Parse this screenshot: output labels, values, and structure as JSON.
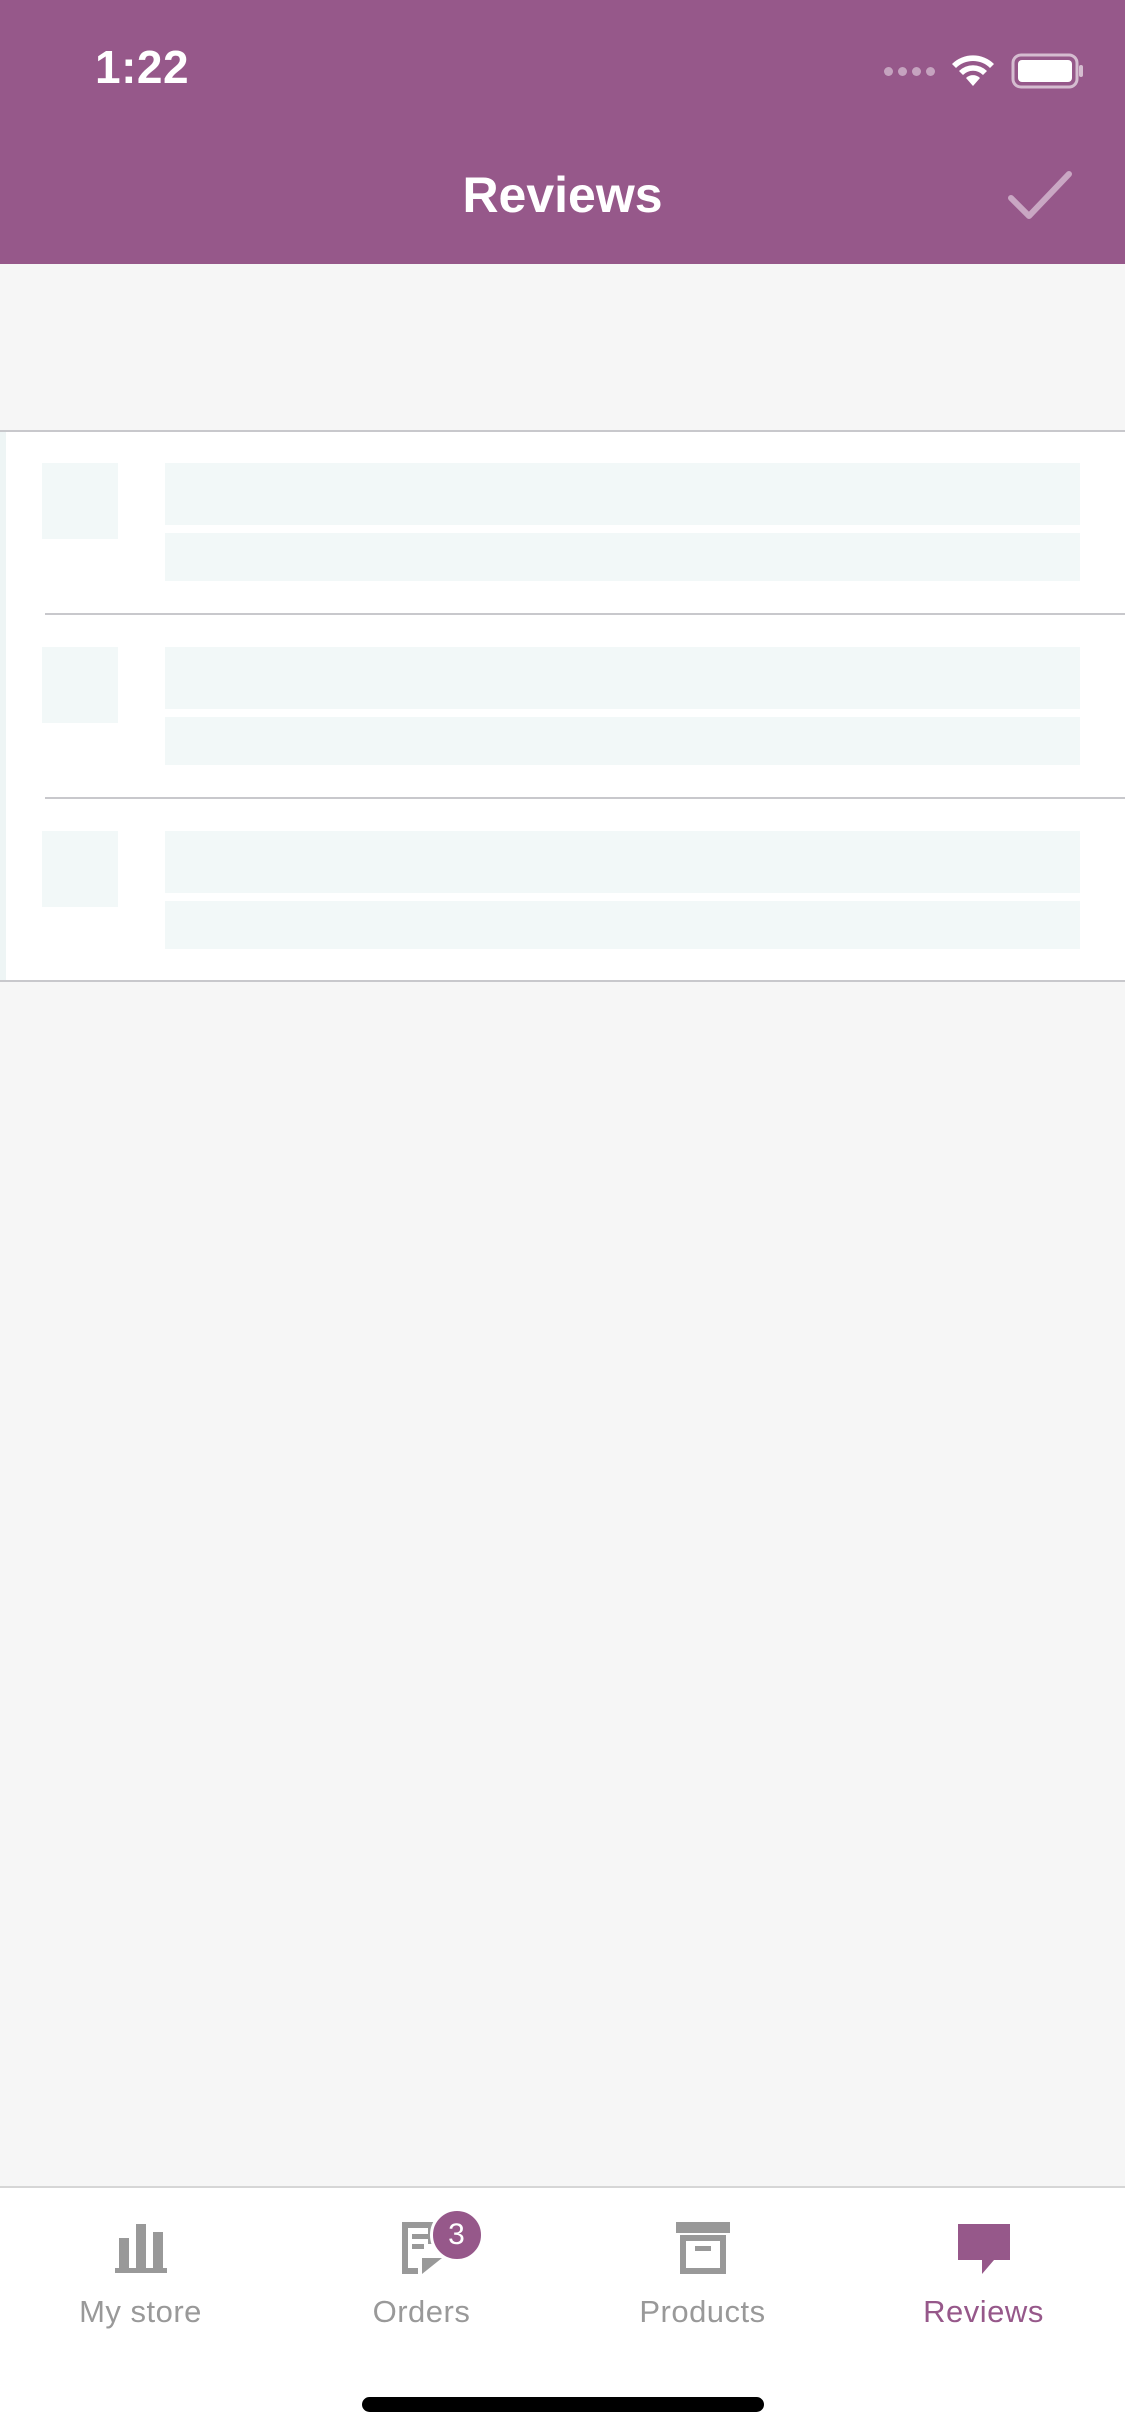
{
  "status_bar": {
    "time": "1:22"
  },
  "header": {
    "title": "Reviews"
  },
  "tabs": [
    {
      "label": "My store",
      "icon": "bar-chart-icon",
      "active": false
    },
    {
      "label": "Orders",
      "icon": "orders-icon",
      "badge": "3",
      "active": false
    },
    {
      "label": "Products",
      "icon": "archive-box-icon",
      "active": false
    },
    {
      "label": "Reviews",
      "icon": "speech-bubble-icon",
      "active": true
    }
  ],
  "colors": {
    "brand": "#96588a",
    "inactive": "#999999",
    "placeholder": "#f2f8f8"
  }
}
